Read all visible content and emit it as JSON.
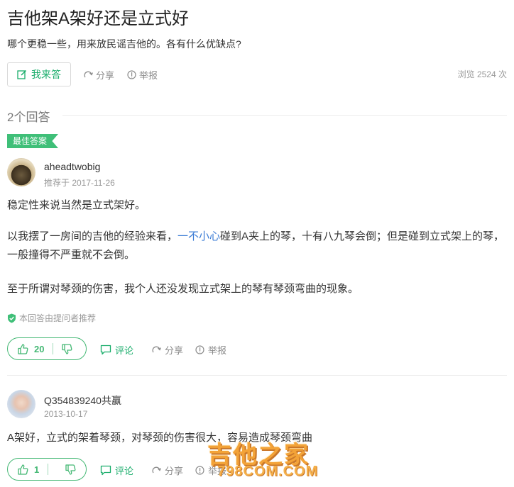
{
  "question": {
    "title": "吉他架A架好还是立式好",
    "description": "哪个更稳一些，用来放民谣吉他的。各有什么优缺点?",
    "answer_button": "我来答",
    "share": "分享",
    "report": "举报",
    "views": "浏览 2524 次"
  },
  "answers_header": "2个回答",
  "answers": [
    {
      "best_tag": "最佳答案",
      "username": "aheadtwobig",
      "date": "推荐于 2017-11-26",
      "paragraphs": {
        "p1": "稳定性来说当然是立式架好。",
        "p2_pre": "以我摆了一房间的吉他的经验来看，",
        "p2_link": "一不小心",
        "p2_post": "碰到A夹上的琴，十有八九琴会倒；但是碰到立式架上的琴，一般撞得不严重就不会倒。",
        "p3": "至于所谓对琴颈的伤害，我个人还没发现立式架上的琴有琴颈弯曲的现象。"
      },
      "recommend_note": "本回答由提问者推荐",
      "upvotes": "20",
      "comment": "评论",
      "share": "分享",
      "report": "举报"
    },
    {
      "username": "Q354839240共赢",
      "date": "2013-10-17",
      "paragraphs": {
        "p1": "A架好，立式的架着琴颈，对琴颈的伤害很大，容易造成琴颈弯曲"
      },
      "upvotes": "1",
      "comment": "评论",
      "share": "分享",
      "report": "举报"
    }
  ],
  "watermark": {
    "main": "吉他之家",
    "sub": "798COM.COM"
  },
  "colors": {
    "accent_green": "#1aad6b",
    "vote_green": "#44b874",
    "link_blue": "#3a7bd5",
    "best_tag_bg": "#3fbf78"
  }
}
